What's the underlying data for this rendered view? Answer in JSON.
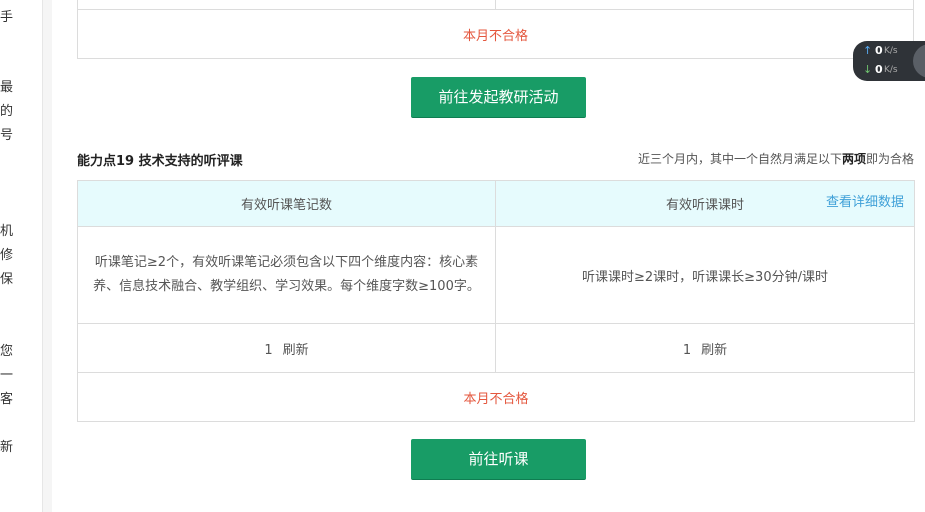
{
  "sidebar_fragments": [
    "手",
    "最",
    "的",
    "号",
    "机",
    "修",
    "保",
    "您",
    "一",
    "客",
    "新"
  ],
  "top_section": {
    "status": "本月不合格",
    "button": "前往发起教研活动"
  },
  "section": {
    "title": "能力点19 技术支持的听评课",
    "note_prefix": "近三个月内，其中一个自然月满足以下",
    "note_bold": "两项",
    "note_suffix": "即为合格",
    "headers": [
      "有效听课笔记数",
      "有效听课课时"
    ],
    "detail_link": "查看详细数据",
    "requirements": [
      "听课笔记≥2个，有效听课笔记必须包含以下四个维度内容：核心素养、信息技术融合、教学组织、学习效果。每个维度字数≥100字。",
      "听课课时≥2课时，听课课长≥30分钟/课时"
    ],
    "counts": [
      "1",
      "1"
    ],
    "refresh_label": "刷新",
    "status": "本月不合格",
    "button": "前往听课"
  },
  "net_widget": {
    "up": "0",
    "down": "0",
    "unit": "K/s"
  }
}
